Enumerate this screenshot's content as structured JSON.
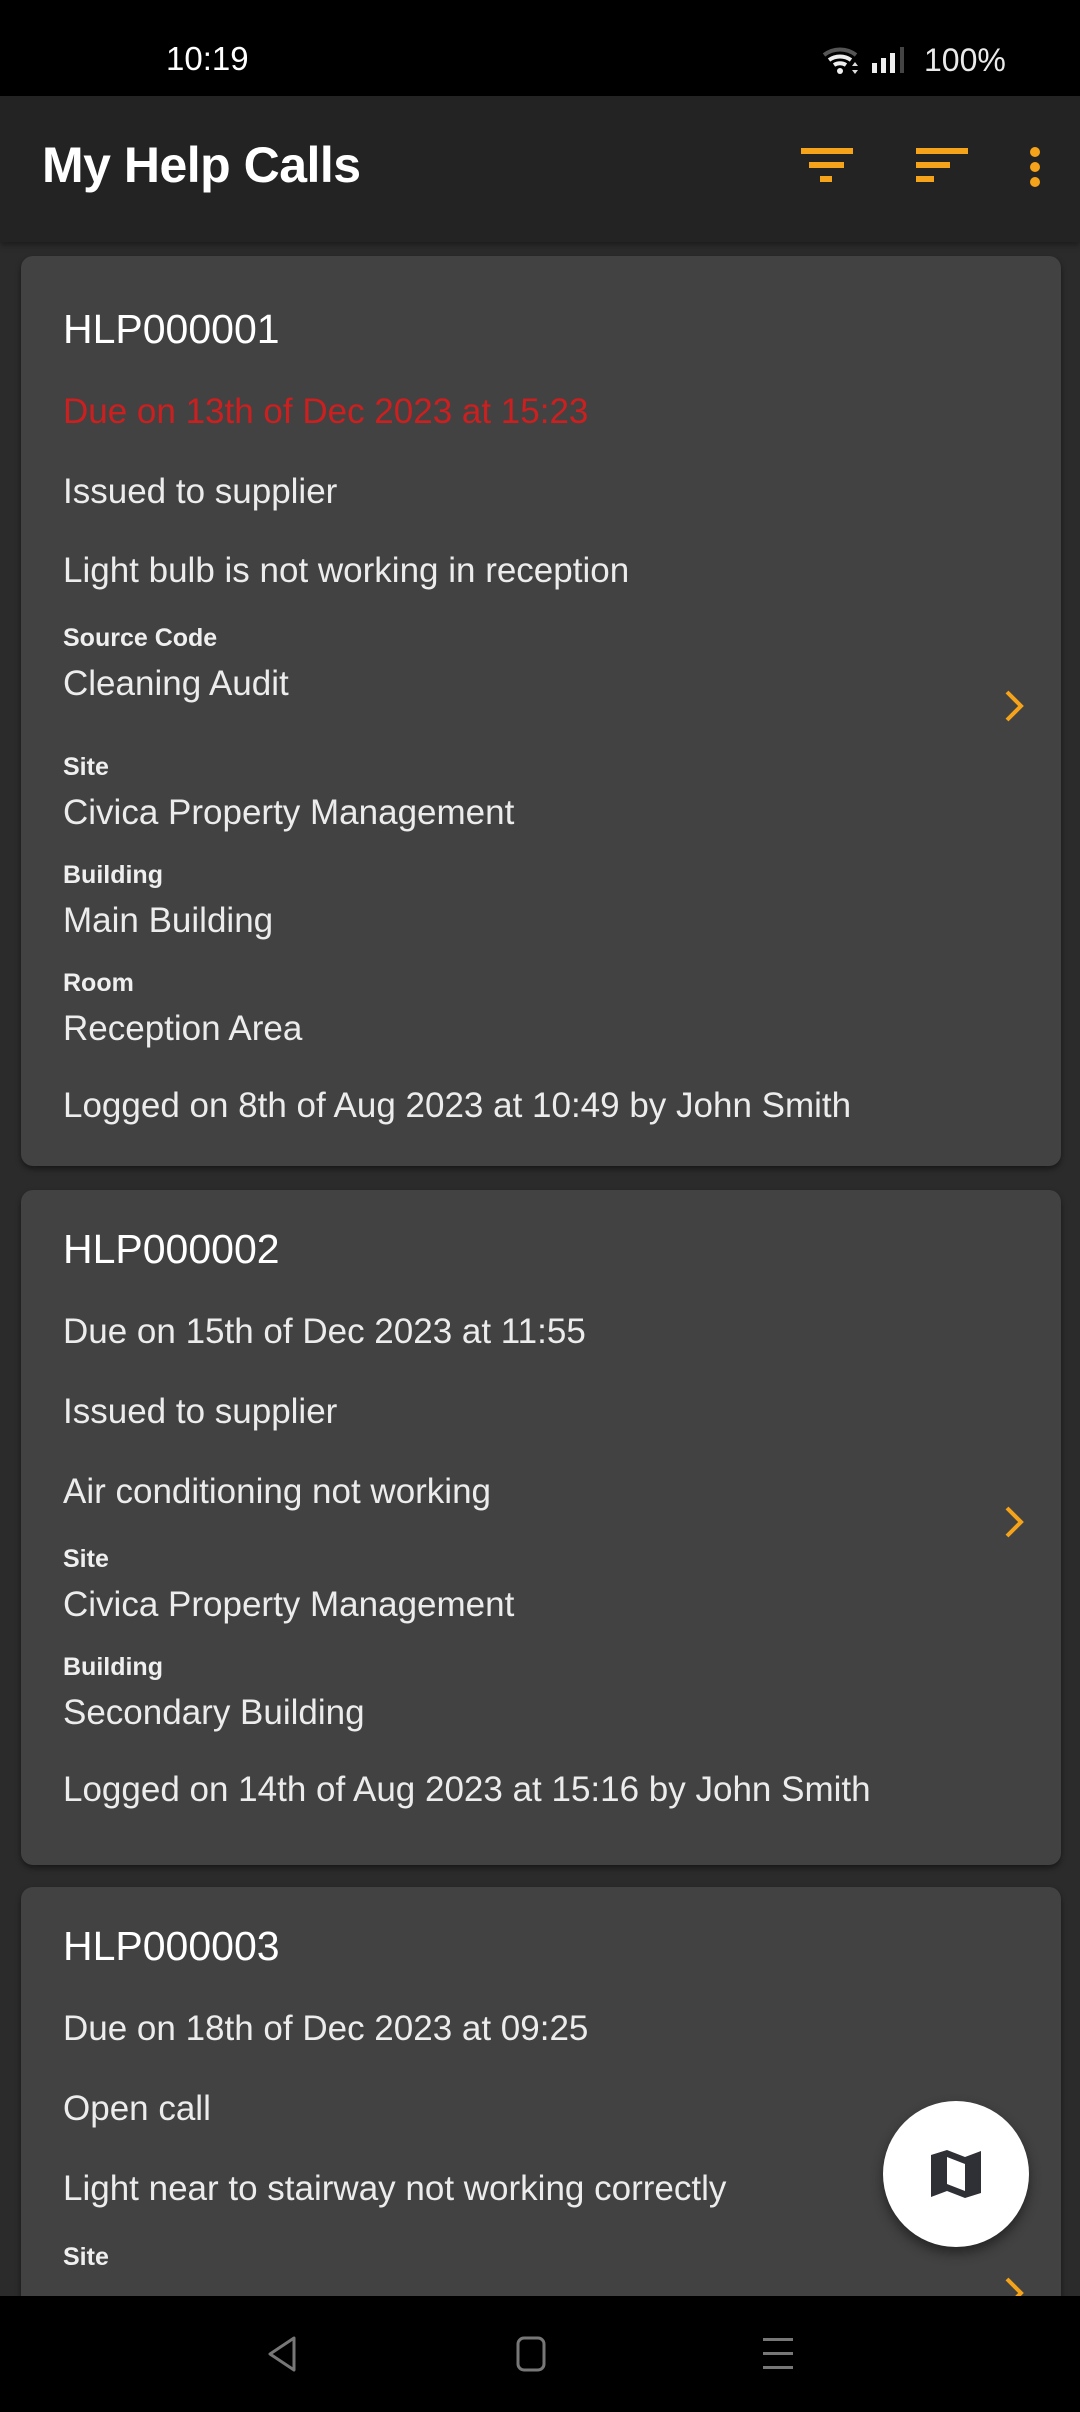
{
  "status_bar": {
    "time": "10:19",
    "battery": "100%",
    "icons": [
      "wifi-icon",
      "signal-icon"
    ]
  },
  "app_bar": {
    "title": "My Help Calls",
    "actions": [
      {
        "name": "filter-icon",
        "label": "Filter"
      },
      {
        "name": "sort-icon",
        "label": "Sort"
      },
      {
        "name": "more-options-icon",
        "label": "More options"
      }
    ]
  },
  "colors": {
    "accent": "#f5a31a",
    "overdue": "#cc1f1f",
    "card_bg": "#424242",
    "page_bg": "#2b2b2b",
    "app_bar_bg": "#232323"
  },
  "calls": [
    {
      "ref": "HLP000001",
      "due": "Due on 13th of Dec 2023 at 15:23",
      "overdue": true,
      "status": "Issued to supplier",
      "description": "Light bulb is not working in reception",
      "fields": [
        {
          "label": "Source Code",
          "value": "Cleaning Audit"
        },
        {
          "label": "Site",
          "value": "Civica Property Management"
        },
        {
          "label": "Building",
          "value": "Main Building"
        },
        {
          "label": "Room",
          "value": "Reception Area"
        }
      ],
      "logged": "Logged on 8th of Aug 2023 at 10:49 by John Smith"
    },
    {
      "ref": "HLP000002",
      "due": "Due on 15th of Dec 2023 at 11:55",
      "overdue": false,
      "status": "Issued to supplier",
      "description": "Air conditioning not working",
      "fields": [
        {
          "label": "Site",
          "value": "Civica Property Management"
        },
        {
          "label": "Building",
          "value": "Secondary Building"
        }
      ],
      "logged": "Logged on 14th of Aug 2023 at 15:16 by John Smith"
    },
    {
      "ref": "HLP000003",
      "due": "Due on 18th of Dec 2023 at 09:25",
      "overdue": false,
      "status": "Open call",
      "description": "Light near to stairway not working correctly",
      "fields": [
        {
          "label": "Site",
          "value": ""
        }
      ],
      "logged": ""
    }
  ],
  "fab": {
    "icon": "map-icon",
    "label": "Map view"
  },
  "nav_bar": {
    "buttons": [
      "back",
      "home",
      "recents"
    ]
  }
}
